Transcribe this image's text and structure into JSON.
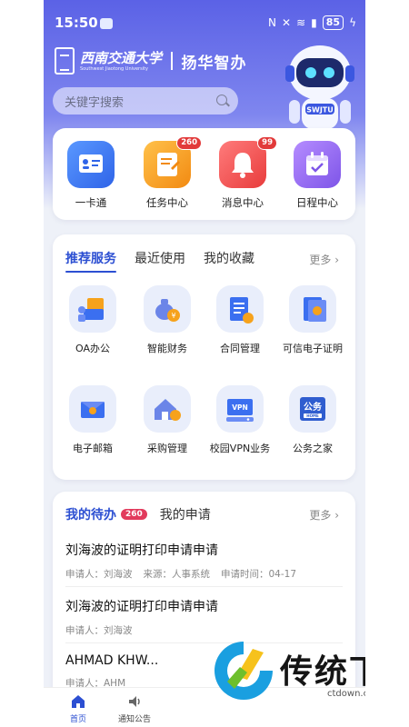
{
  "status_bar": {
    "time": "15:50",
    "battery": "85"
  },
  "header": {
    "university_cn": "西南交通大学",
    "university_en": "Southwest Jiaotong University",
    "app_name": "扬华智办",
    "robot_badge": "SWJTU"
  },
  "search": {
    "placeholder": "关键字搜索"
  },
  "quick_actions": [
    {
      "label": "一卡通",
      "icon": "id-card-icon",
      "color": "#3b7af0"
    },
    {
      "label": "任务中心",
      "icon": "task-icon",
      "color": "#f6a21c",
      "badge": "260"
    },
    {
      "label": "消息中心",
      "icon": "bell-icon",
      "color": "#ef5454",
      "badge": "99"
    },
    {
      "label": "日程中心",
      "icon": "calendar-icon",
      "color": "#9a6ff0"
    }
  ],
  "services": {
    "tabs": [
      "推荐服务",
      "最近使用",
      "我的收藏"
    ],
    "more": "更多",
    "items": [
      {
        "label": "OA办公",
        "icon": "office-icon"
      },
      {
        "label": "智能财务",
        "icon": "finance-icon"
      },
      {
        "label": "合同管理",
        "icon": "contract-icon"
      },
      {
        "label": "可信电子证明",
        "icon": "certificate-icon"
      },
      {
        "label": "电子邮箱",
        "icon": "email-icon"
      },
      {
        "label": "采购管理",
        "icon": "procurement-icon"
      },
      {
        "label": "校园VPN业务",
        "icon": "vpn-icon",
        "icon_text": "VPN"
      },
      {
        "label": "公务之家",
        "icon": "public-affairs-icon",
        "icon_text": "公务",
        "icon_subtext": "HOME"
      }
    ]
  },
  "todo": {
    "tabs": [
      "我的待办",
      "我的申请"
    ],
    "count": "260",
    "more": "更多",
    "rows": [
      {
        "title": "刘海波的证明打印申请申请",
        "applicant": "申请人：刘海波",
        "source": "来源：人事系统",
        "time": "申请时间：04-17"
      },
      {
        "title": "刘海波的证明打印申请申请",
        "applicant": "申请人：刘海波",
        "source": "",
        "time": ""
      },
      {
        "title": "AHMAD KHW...",
        "applicant": "申请人：AHM",
        "source": "",
        "time": ""
      }
    ]
  },
  "tab_bar": [
    {
      "label": "首页",
      "icon": "home-icon",
      "active": true
    },
    {
      "label": "通知公告",
      "icon": "speaker-icon",
      "active": false
    }
  ],
  "watermark": {
    "text": "传统下载",
    "url": "ctdown.com"
  },
  "colors": {
    "accent": "#2c4fd2",
    "hero": "#5b62e6",
    "badge": "#e23a3a"
  }
}
